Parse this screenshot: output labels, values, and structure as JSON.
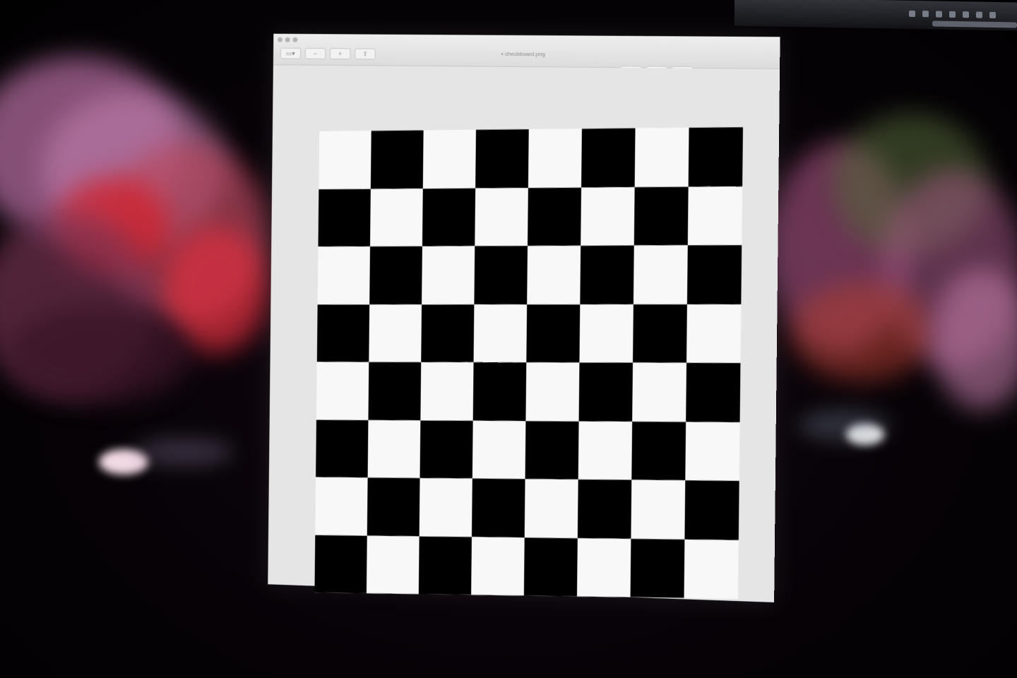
{
  "window": {
    "title": "checkboard.png",
    "title_icon": "image-file-icon"
  },
  "toolbar": {
    "left": [
      {
        "name": "sidebar-toggle-button",
        "icon": "sidebar-icon",
        "glyph": "▭▾"
      },
      {
        "name": "zoom-out-button",
        "icon": "zoom-out-icon",
        "glyph": "−"
      },
      {
        "name": "zoom-in-button",
        "icon": "zoom-in-icon",
        "glyph": "+"
      },
      {
        "name": "share-button",
        "icon": "share-icon",
        "glyph": "⇪"
      }
    ],
    "right": [
      {
        "name": "markup-button",
        "icon": "pen-icon",
        "glyph": "✎"
      },
      {
        "name": "rotate-button",
        "icon": "rotate-icon",
        "glyph": "↻"
      },
      {
        "name": "highlight-button",
        "icon": "highlight-icon",
        "glyph": "◐"
      }
    ]
  },
  "board": {
    "rows": 8,
    "cols": 8,
    "first_square": "light",
    "dark_color": "#000000",
    "light_color": "#f8f8f8"
  }
}
